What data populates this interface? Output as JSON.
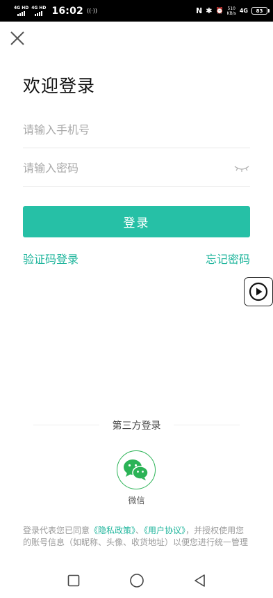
{
  "status_bar": {
    "net1": "4G HD",
    "net2": "4G HD",
    "time": "16:02",
    "nfc_left": "((·))",
    "nfc_icon": "N",
    "bluetooth_icon": "✱",
    "alarm_icon": "⏰",
    "speed_value": "510",
    "speed_unit": "KB/s",
    "net_type": "4G",
    "battery": "83"
  },
  "page": {
    "title": "欢迎登录"
  },
  "form": {
    "phone_placeholder": "请输入手机号",
    "password_placeholder": "请输入密码",
    "login_label": "登录"
  },
  "links": {
    "sms_login": "验证码登录",
    "forgot_password": "忘记密码"
  },
  "third_party": {
    "title": "第三方登录",
    "wechat_label": "微信"
  },
  "agreement": {
    "prefix": "登录代表您已同意",
    "privacy": "《隐私政策》",
    "sep": "、",
    "terms": "《用户协议》",
    "suffix": "，并授权使用您的账号信息（如昵称、头像、收货地址）以便您进行统一管理"
  },
  "colors": {
    "accent": "#26c0a6",
    "link": "#1fb59c",
    "wechat": "#2bb356"
  }
}
